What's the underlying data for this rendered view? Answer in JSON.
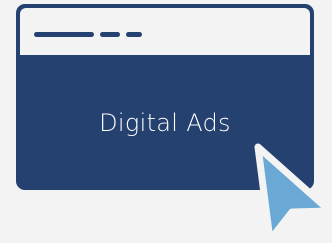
{
  "window": {
    "label": "Digital Ads"
  },
  "colors": {
    "background": "#f3f3f3",
    "window": "#24416f",
    "cursor": "#6aa9d6"
  },
  "icons": {
    "cursor": "cursor-arrow-icon"
  }
}
